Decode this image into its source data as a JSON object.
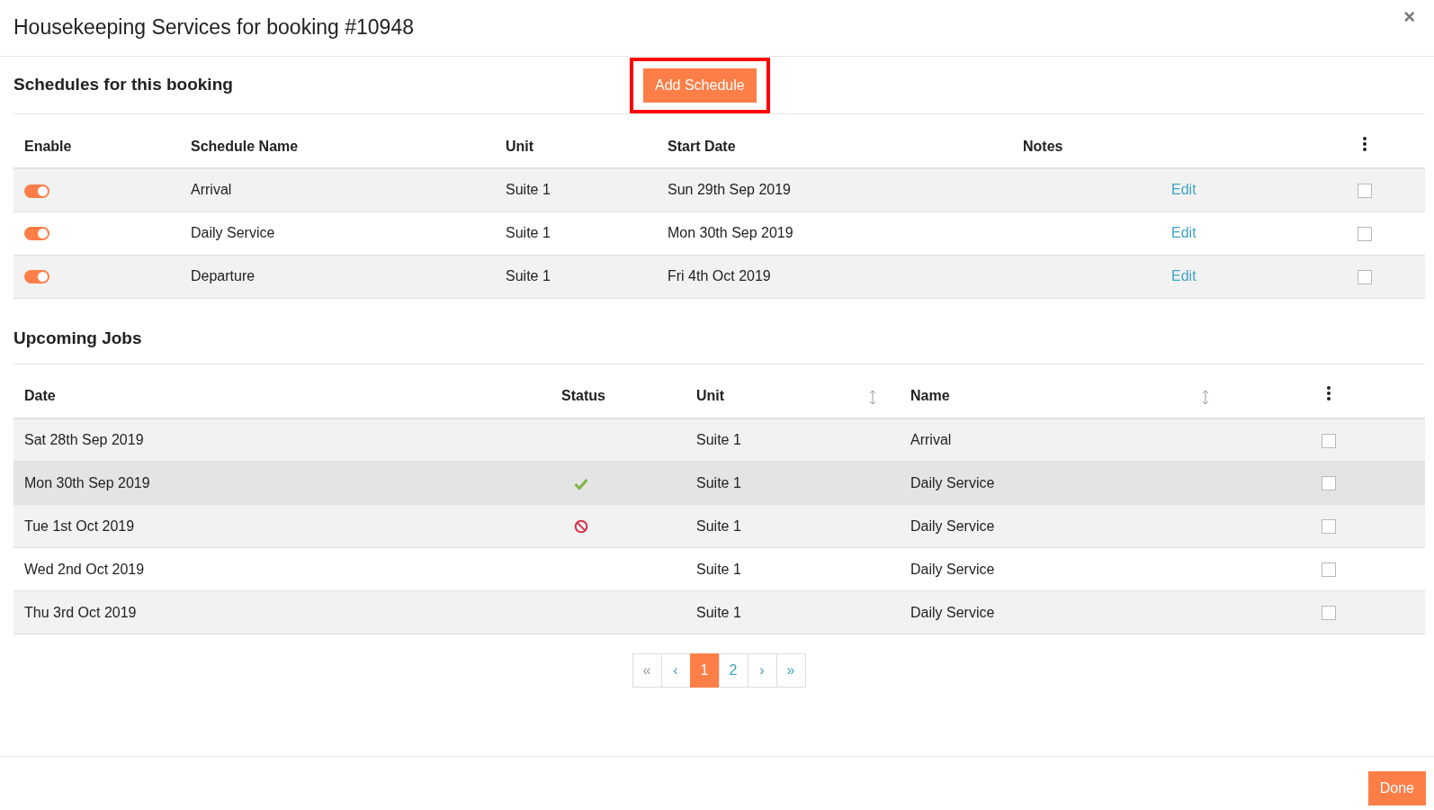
{
  "dialog": {
    "title": "Housekeeping Services for booking #10948",
    "close_label": "×"
  },
  "schedules": {
    "heading": "Schedules for this booking",
    "add_button": {
      "label": "Add Schedule",
      "highlighted": true
    },
    "columns": [
      "Enable",
      "Schedule Name",
      "Unit",
      "Start Date",
      "Notes"
    ],
    "rows": [
      {
        "enabled": true,
        "name": "Arrival",
        "unit": "Suite 1",
        "start_date": "Sun 29th Sep 2019",
        "action": "Edit",
        "checked": false
      },
      {
        "enabled": true,
        "name": "Daily Service",
        "unit": "Suite 1",
        "start_date": "Mon 30th Sep 2019",
        "action": "Edit",
        "checked": false
      },
      {
        "enabled": true,
        "name": "Departure",
        "unit": "Suite 1",
        "start_date": "Fri 4th Oct 2019",
        "action": "Edit",
        "checked": false
      }
    ]
  },
  "jobs": {
    "heading": "Upcoming Jobs",
    "columns": [
      {
        "label": "Date",
        "sortable": false
      },
      {
        "label": "Status",
        "sortable": false
      },
      {
        "label": "Unit",
        "sortable": true
      },
      {
        "label": "Name",
        "sortable": true
      }
    ],
    "rows": [
      {
        "date": "Sat 28th Sep 2019",
        "completed": false,
        "cancelled": false,
        "unit": "Suite 1",
        "name": "Arrival",
        "checked": false,
        "hovered": false
      },
      {
        "date": "Mon 30th Sep 2019",
        "completed": true,
        "cancelled": false,
        "unit": "Suite 1",
        "name": "Daily Service",
        "checked": false,
        "hovered": true
      },
      {
        "date": "Tue 1st Oct 2019",
        "completed": false,
        "cancelled": true,
        "unit": "Suite 1",
        "name": "Daily Service",
        "checked": false,
        "hovered": false
      },
      {
        "date": "Wed 2nd Oct 2019",
        "completed": false,
        "cancelled": false,
        "unit": "Suite 1",
        "name": "Daily Service",
        "checked": false,
        "hovered": false
      },
      {
        "date": "Thu 3rd Oct 2019",
        "completed": false,
        "cancelled": false,
        "unit": "Suite 1",
        "name": "Daily Service",
        "checked": false,
        "hovered": false
      }
    ]
  },
  "pagination": [
    {
      "label": "«",
      "selected": false
    },
    {
      "label": "‹",
      "selected": false
    },
    {
      "label": "1",
      "selected": true
    },
    {
      "label": "2",
      "selected": false
    },
    {
      "label": "›",
      "selected": false
    },
    {
      "label": "»",
      "selected": false
    }
  ],
  "done_button": "Done"
}
